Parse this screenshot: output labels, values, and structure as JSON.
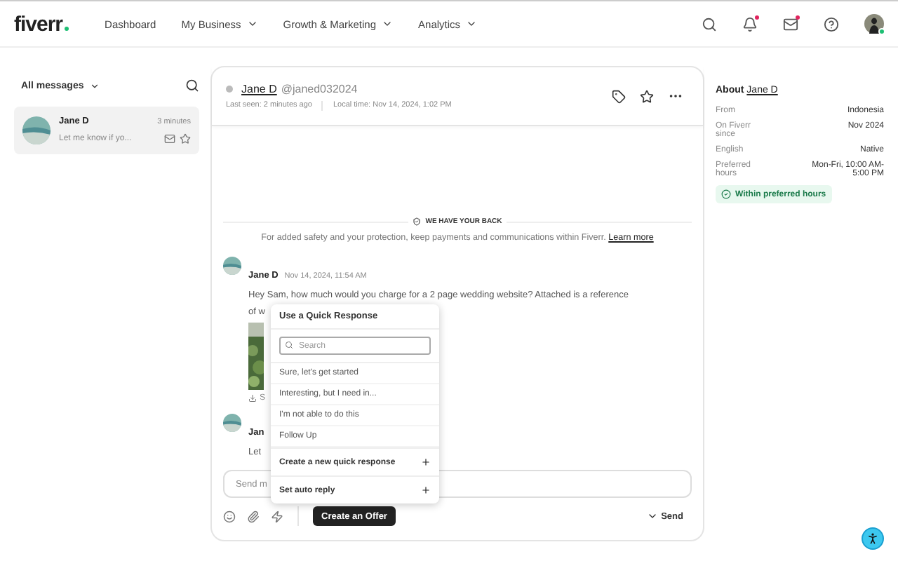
{
  "nav": {
    "logo": "fiverr",
    "items": [
      {
        "label": "Dashboard",
        "dropdown": false
      },
      {
        "label": "My Business",
        "dropdown": true
      },
      {
        "label": "Growth & Marketing",
        "dropdown": true
      },
      {
        "label": "Analytics",
        "dropdown": true
      }
    ],
    "notifications_unread": true,
    "messages_unread": true,
    "user_online": true
  },
  "inbox": {
    "filter": "All messages",
    "conversations": [
      {
        "name": "Jane D",
        "time": "3 minutes",
        "preview": "Let me know if yo...",
        "selected": true
      }
    ]
  },
  "chat": {
    "contact": {
      "name": "Jane D",
      "handle": "@janed032024",
      "online": false,
      "last_seen": "Last seen: 2 minutes ago",
      "local_time": "Local time: Nov 14, 2024, 1:02 PM"
    },
    "notice": {
      "title": "WE HAVE YOUR BACK",
      "text": "For added safety and your protection, keep payments and communications within Fiverr.",
      "link": "Learn more"
    },
    "messages": [
      {
        "name": "Jane D",
        "time": "Nov 14, 2024, 11:54 AM",
        "lines": [
          "Hey Sam, how much would you charge for a 2 page wedding website? Attached is a reference",
          "of w"
        ],
        "attachment": {
          "kind": "picture",
          "label": "S"
        }
      },
      {
        "name": "Jan",
        "lines": [
          "Let"
        ]
      }
    ],
    "composer": {
      "placeholder": "Send m",
      "offer_button": "Create an Offer",
      "send": "Send"
    }
  },
  "quick_response": {
    "title": "Use a Quick Response",
    "search_placeholder": "Search",
    "responses": [
      "Sure, let's get started",
      "Interesting, but I need in...",
      "I'm not able to do this",
      "Follow Up"
    ],
    "actions": [
      "Create a new quick response",
      "Set auto reply"
    ]
  },
  "about": {
    "title": "About",
    "name": "Jane D",
    "rows": [
      {
        "label": "From",
        "value": "Indonesia"
      },
      {
        "label": "On Fiverr since",
        "value": "Nov 2024"
      },
      {
        "label": "English",
        "value": "Native"
      },
      {
        "label": "Preferred hours",
        "value": "Mon-Fri, 10:00 AM-5:00 PM"
      }
    ],
    "status": "Within preferred hours"
  }
}
